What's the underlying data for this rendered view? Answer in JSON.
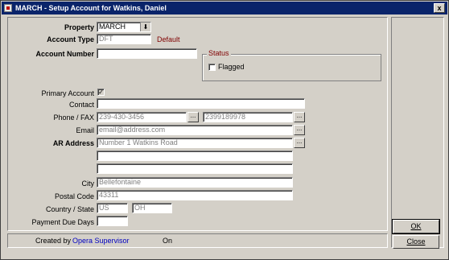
{
  "window": {
    "title": "MARCH - Setup Account for Watkins, Daniel",
    "close_label": "x"
  },
  "form": {
    "property": {
      "label": "Property",
      "value": "MARCH"
    },
    "account_type": {
      "label": "Account Type",
      "value": "DFT",
      "default_label": "Default"
    },
    "account_number": {
      "label": "Account Number",
      "value": ""
    },
    "status": {
      "label": "Status",
      "flagged_label": "Flagged",
      "flagged": false
    },
    "primary_account": {
      "label": "Primary Account",
      "checked": true,
      "check_mark": "✓"
    },
    "contact": {
      "label": "Contact",
      "value": ""
    },
    "phone_fax": {
      "label": "Phone / FAX",
      "phone": "239-430-3456",
      "fax": "2399189978"
    },
    "email": {
      "label": "Email",
      "value": "email@address.com"
    },
    "ar_address": {
      "label": "AR Address",
      "line1": "Number 1 Watkins Road",
      "line2": "",
      "line3": ""
    },
    "city": {
      "label": "City",
      "value": "Bellefontaine"
    },
    "postal_code": {
      "label": "Postal Code",
      "value": "43311"
    },
    "country_state": {
      "label": "Country / State",
      "country": "US",
      "state": "OH"
    },
    "payment_due_days": {
      "label": "Payment Due Days",
      "value": ""
    }
  },
  "footer": {
    "created_by_label": "Created by",
    "created_by_user": "Opera Supervisor",
    "on_label": "On"
  },
  "buttons": {
    "ok": "OK",
    "close": "Close"
  },
  "lookup_label": "...",
  "dropdown_arrow": "⬇",
  "colors": {
    "titlebar": "#0a246a",
    "default_text": "#800000",
    "link": "#0000c0"
  }
}
